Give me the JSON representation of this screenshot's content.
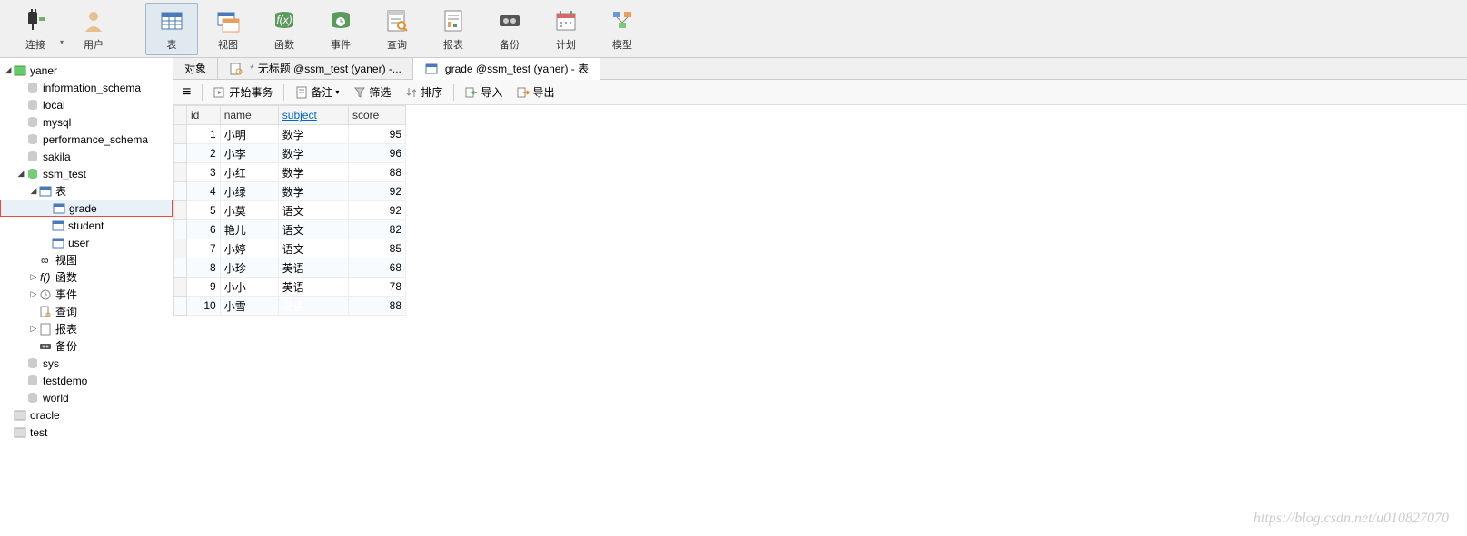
{
  "toolbar": [
    {
      "key": "connect",
      "label": "连接"
    },
    {
      "key": "user",
      "label": "用户"
    },
    {
      "key": "table",
      "label": "表",
      "active": true
    },
    {
      "key": "view",
      "label": "视图"
    },
    {
      "key": "func",
      "label": "函数"
    },
    {
      "key": "event",
      "label": "事件"
    },
    {
      "key": "query",
      "label": "查询"
    },
    {
      "key": "report",
      "label": "报表"
    },
    {
      "key": "backup",
      "label": "备份"
    },
    {
      "key": "schedule",
      "label": "计划"
    },
    {
      "key": "model",
      "label": "模型"
    }
  ],
  "tree": {
    "conn": "yaner",
    "dbs_closed_top": [
      "information_schema",
      "local",
      "mysql",
      "performance_schema",
      "sakila"
    ],
    "open_db": "ssm_test",
    "tables_label": "表",
    "tables": [
      "grade",
      "student",
      "user"
    ],
    "selected_table": "grade",
    "nodes": [
      {
        "label": "视图",
        "icon": "view"
      },
      {
        "label": "函数",
        "icon": "fx",
        "expandable": true
      },
      {
        "label": "事件",
        "icon": "event",
        "expandable": true
      },
      {
        "label": "查询",
        "icon": "query"
      },
      {
        "label": "报表",
        "icon": "report",
        "expandable": true
      },
      {
        "label": "备份",
        "icon": "backup"
      }
    ],
    "dbs_closed_bottom": [
      "sys",
      "testdemo",
      "world"
    ],
    "other_conns": [
      "oracle",
      "test"
    ]
  },
  "tabs": [
    {
      "label": "对象",
      "icon": "none"
    },
    {
      "label": "无标题 @ssm_test (yaner) -...",
      "icon": "query",
      "dirty": true
    },
    {
      "label": "grade @ssm_test (yaner) - 表",
      "icon": "table",
      "active": true
    }
  ],
  "actions": {
    "menu": "≡",
    "begin_tx": "开始事务",
    "memo": "备注",
    "filter": "筛选",
    "sort": "排序",
    "import": "导入",
    "export": "导出"
  },
  "grid": {
    "columns": [
      "id",
      "name",
      "subject",
      "score"
    ],
    "sorted_col": "subject",
    "rows": [
      {
        "id": 1,
        "name": "小明",
        "subject": "数学",
        "score": 95
      },
      {
        "id": 2,
        "name": "小李",
        "subject": "数学",
        "score": 96
      },
      {
        "id": 3,
        "name": "小红",
        "subject": "数学",
        "score": 88
      },
      {
        "id": 4,
        "name": "小绿",
        "subject": "数学",
        "score": 92
      },
      {
        "id": 5,
        "name": "小莫",
        "subject": "语文",
        "score": 92
      },
      {
        "id": 6,
        "name": "艳儿",
        "subject": "语文",
        "score": 82
      },
      {
        "id": 7,
        "name": "小婷",
        "subject": "语文",
        "score": 85
      },
      {
        "id": 8,
        "name": "小珍",
        "subject": "英语",
        "score": 68
      },
      {
        "id": 9,
        "name": "小小",
        "subject": "英语",
        "score": 78
      },
      {
        "id": 10,
        "name": "小雪",
        "subject": "英语",
        "score": 88
      }
    ],
    "current_row": 10,
    "selected_cell": {
      "row": 10,
      "col": "subject"
    }
  },
  "watermark": "https://blog.csdn.net/u010827070"
}
